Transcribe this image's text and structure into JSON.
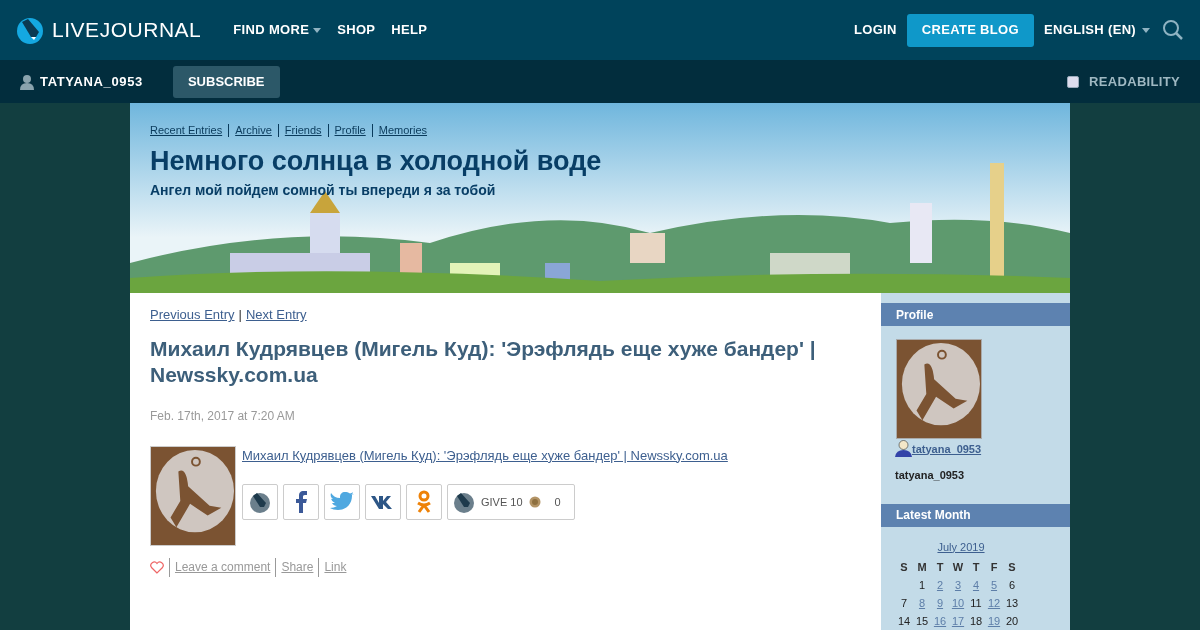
{
  "topbar": {
    "logo": "LIVEJOURNAL",
    "nav": [
      {
        "label": "FIND MORE",
        "dropdown": true
      },
      {
        "label": "SHOP",
        "dropdown": false
      },
      {
        "label": "HELP",
        "dropdown": false
      }
    ],
    "login": "LOGIN",
    "create": "CREATE BLOG",
    "language": "ENGLISH (EN)"
  },
  "userbar": {
    "user": "TATYANA_0953",
    "subscribe": "SUBSCRIBE",
    "readability": {
      "label": "READABILITY",
      "checked": false
    }
  },
  "journal": {
    "links": [
      "Recent Entries",
      "Archive",
      "Friends",
      "Profile",
      "Memories"
    ],
    "title": "Немного солнца в холодной воде",
    "subtitle": "Ангел мой пойдем сомной ты впереди я за тобой",
    "banner": {
      "kind": "picture"
    }
  },
  "entry": {
    "prev": "Previous Entry",
    "separator": "|",
    "next": "Next Entry",
    "title": "Михаил Кудрявцев (Мигель Куд): 'Эрэфлядь еще хуже бандер' | Newssky.com.ua",
    "date": "Feb. 17th, 2017 at 7:20 AM",
    "link": "Михаил Кудрявцев (Мигель Куд): 'Эрэфлядь еще хуже бандер' | Newssky.com.ua",
    "share": [
      {
        "kind": "livejournal"
      },
      {
        "kind": "facebook"
      },
      {
        "kind": "twitter"
      },
      {
        "kind": "vk"
      },
      {
        "kind": "odnoklassniki"
      }
    ],
    "give": {
      "label": "GIVE 10",
      "count": "0"
    },
    "actions": [
      "Leave a comment",
      "Share",
      "Link"
    ]
  },
  "sidebar": {
    "profile": {
      "heading": "Profile",
      "userlink": "tatyana_0953",
      "name": "tatyana_0953"
    },
    "month": {
      "heading": "Latest Month",
      "title": "July 2019",
      "weekdays": [
        "S",
        "M",
        "T",
        "W",
        "T",
        "F",
        "S"
      ],
      "weeks": [
        [
          {
            "day": "1",
            "linked": false
          },
          {
            "day": "2",
            "linked": true
          },
          {
            "day": "3",
            "linked": true
          },
          {
            "day": "4",
            "linked": true
          },
          {
            "day": "5",
            "linked": true
          },
          {
            "day": "6",
            "linked": false
          }
        ],
        [
          {
            "day": "7",
            "linked": false
          },
          {
            "day": "8",
            "linked": true
          },
          {
            "day": "9",
            "linked": true
          },
          {
            "day": "10",
            "linked": true
          },
          {
            "day": "11",
            "linked": false
          },
          {
            "day": "12",
            "linked": true
          },
          {
            "day": "13",
            "linked": false
          }
        ],
        [
          {
            "day": "14",
            "linked": false
          },
          {
            "day": "15",
            "linked": false
          },
          {
            "day": "16",
            "linked": true
          },
          {
            "day": "17",
            "linked": true
          },
          {
            "day": "18",
            "linked": false
          },
          {
            "day": "19",
            "linked": true
          },
          {
            "day": "20",
            "linked": false
          }
        ]
      ]
    }
  }
}
